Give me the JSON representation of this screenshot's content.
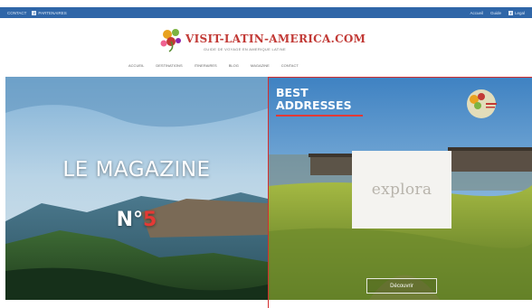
{
  "topbar": {
    "left_items": [
      "CONTACT",
      "PARTENAIRES"
    ],
    "right_items": [
      "Accueil",
      "Guide",
      "Legal"
    ]
  },
  "logo": {
    "name": "VISIT-LATIN-AMERICA.COM",
    "tagline": "GUIDE DE VOYAGE EN AMERIQUE LATINE"
  },
  "nav": {
    "items": [
      "ACCUEIL",
      "DESTINATIONS",
      "ITINERAIRES",
      "BLOG",
      "MAGAZINE",
      "CONTACT"
    ]
  },
  "hero_left": {
    "title": "LE MAGAZINE",
    "number_prefix": "N°",
    "number": "5"
  },
  "hero_right": {
    "heading_line1": "BEST",
    "heading_line2": "ADDRESSES",
    "partner_name": "explora",
    "button_label": "Découvrir"
  },
  "colors": {
    "brand_blue": "#2f66a8",
    "accent_red": "#e53935",
    "logo_red": "#c23a36"
  }
}
